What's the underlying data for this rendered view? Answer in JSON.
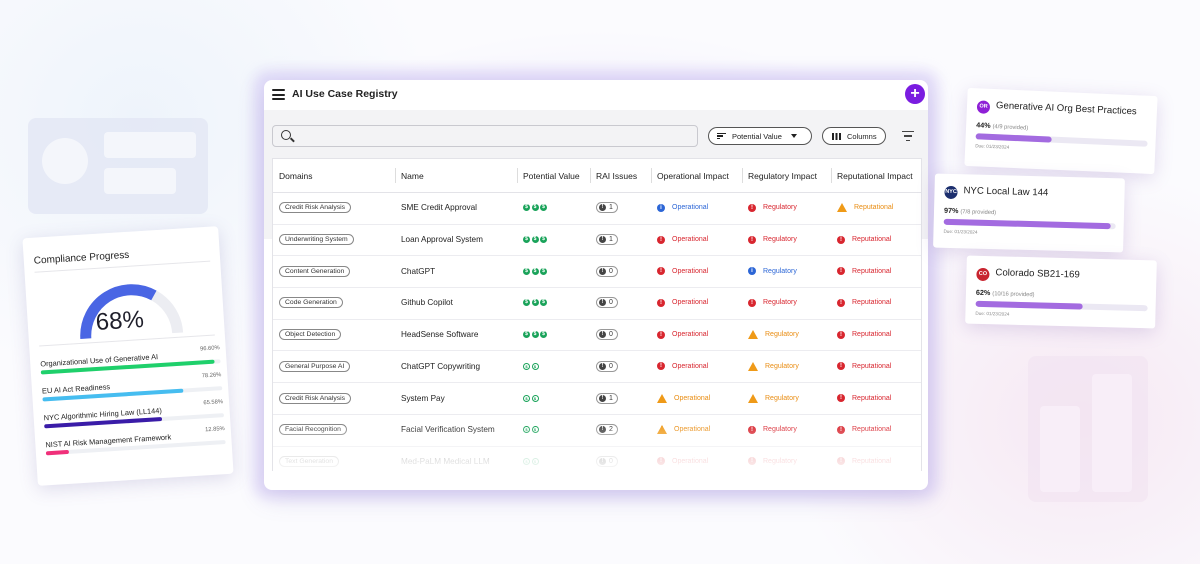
{
  "app": {
    "title": "AI Use Case Registry",
    "add_label": "+"
  },
  "search": {
    "placeholder": ""
  },
  "toolbar": {
    "potential_value_label": "Potential Value",
    "columns_label": "Columns"
  },
  "table": {
    "headers": [
      "Domains",
      "Name",
      "Potential Value",
      "RAI Issues",
      "Operational Impact",
      "Regulatory Impact",
      "Reputational Impact"
    ],
    "rows": [
      {
        "domain": "Credit Risk Analysis",
        "name": "SME Credit Approval",
        "value_level": 3,
        "rai": "1",
        "operational": "Operational",
        "operational_status": "info",
        "regulatory": "Regulatory",
        "regulatory_status": "high",
        "reputational": "Reputational",
        "reputational_status": "warning"
      },
      {
        "domain": "Underwriting System",
        "name": "Loan Approval System",
        "value_level": 3,
        "rai": "1",
        "operational": "Operational",
        "operational_status": "high",
        "regulatory": "Regulatory",
        "regulatory_status": "high",
        "reputational": "Reputational",
        "reputational_status": "high"
      },
      {
        "domain": "Content Generation",
        "name": "ChatGPT",
        "value_level": 3,
        "rai": "0",
        "operational": "Operational",
        "operational_status": "high",
        "regulatory": "Regulatory",
        "regulatory_status": "info",
        "reputational": "Reputational",
        "reputational_status": "high"
      },
      {
        "domain": "Code Generation",
        "name": "Github Copilot",
        "value_level": 3,
        "rai": "0",
        "operational": "Operational",
        "operational_status": "high",
        "regulatory": "Regulatory",
        "regulatory_status": "high",
        "reputational": "Reputational",
        "reputational_status": "high"
      },
      {
        "domain": "Object Detection",
        "name": "HeadSense Software",
        "value_level": 3,
        "rai": "0",
        "operational": "Operational",
        "operational_status": "high",
        "regulatory": "Regulatory",
        "regulatory_status": "warning",
        "reputational": "Reputational",
        "reputational_status": "high"
      },
      {
        "domain": "General Purpose AI",
        "name": "ChatGPT Copywriting",
        "value_level": 2,
        "rai": "0",
        "operational": "Operational",
        "operational_status": "high",
        "regulatory": "Regulatory",
        "regulatory_status": "warning",
        "reputational": "Reputational",
        "reputational_status": "high"
      },
      {
        "domain": "Credit Risk Analysis",
        "name": "System Pay",
        "value_level": 2,
        "rai": "1",
        "operational": "Operational",
        "operational_status": "warning",
        "regulatory": "Regulatory",
        "regulatory_status": "warning",
        "reputational": "Reputational",
        "reputational_status": "high"
      },
      {
        "domain": "Facial Recognition",
        "name": "Facial Verification System",
        "value_level": 2,
        "rai": "2",
        "operational": "Operational",
        "operational_status": "warning",
        "regulatory": "Regulatory",
        "regulatory_status": "high",
        "reputational": "Reputational",
        "reputational_status": "high"
      },
      {
        "domain": "Text Generation",
        "name": "Med-PaLM Medical LLM",
        "value_level": 2,
        "rai": "0",
        "operational": "Operational",
        "operational_status": "high",
        "regulatory": "Regulatory",
        "regulatory_status": "high",
        "reputational": "Reputational",
        "reputational_status": "high"
      }
    ]
  },
  "compliance": {
    "title": "Compliance Progress",
    "overall_percent": "68%",
    "overall_fraction": 0.68,
    "items": [
      {
        "label": "Organizational Use of Generative AI",
        "value": "96.60%",
        "fraction": 0.966,
        "color": "#1fd06b"
      },
      {
        "label": "EU AI Act Readiness",
        "value": "78.26%",
        "fraction": 0.7826,
        "color": "#46bdf0"
      },
      {
        "label": "NYC Algorithmic Hiring Law (LL144)",
        "value": "65.58%",
        "fraction": 0.6558,
        "color": "#3a1ca8"
      },
      {
        "label": "NIST AI Risk Management Framework",
        "value": "12.85%",
        "fraction": 0.1285,
        "color": "#f0307a"
      }
    ]
  },
  "frameworks": [
    {
      "logo_text": "OR",
      "logo_color": "#8e1fd6",
      "title": "Generative AI Org Best Practices",
      "percent": "44%",
      "provided": "(4/9 provided)",
      "fraction": 0.44,
      "due": "Due: 01/23/2024"
    },
    {
      "logo_text": "NYC",
      "logo_color": "#1c2f6e",
      "title": "NYC Local Law 144",
      "percent": "97%",
      "provided": "(7/8 provided)",
      "fraction": 0.97,
      "due": "Due: 01/23/2024"
    },
    {
      "logo_text": "CO",
      "logo_color": "#c8242f",
      "title": "Colorado SB21-169",
      "percent": "62%",
      "provided": "(10/16 provided)",
      "fraction": 0.62,
      "due": "Due: 01/23/2024"
    }
  ]
}
